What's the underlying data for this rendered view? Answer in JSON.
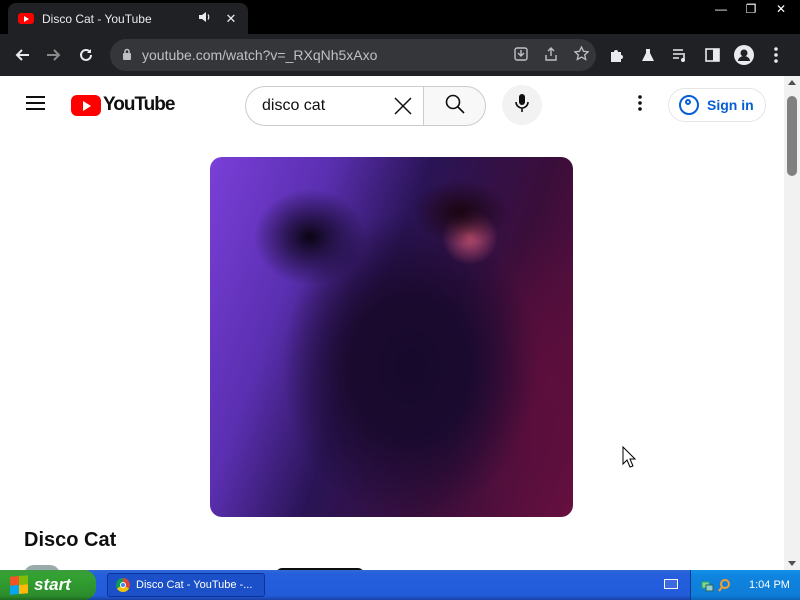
{
  "browser": {
    "tab": {
      "title": "Disco Cat - YouTube",
      "audio_icon": "speaker-icon",
      "close_glyph": "✕"
    },
    "window_controls": {
      "minimize": "—",
      "restore": "❐",
      "close": "✕"
    },
    "address": {
      "url": "youtube.com/watch?v=_RXqNh5xAxo"
    }
  },
  "youtube": {
    "logo_text": "YouTube",
    "search": {
      "value": "disco cat",
      "clear_glyph": "✕"
    },
    "signin_label": "Sign in",
    "video": {
      "title": "Disco Cat"
    },
    "colors": {
      "brand_red": "#ff0000",
      "link_blue": "#065fd4"
    }
  },
  "taskbar": {
    "start_label": "start",
    "task_item": "Disco Cat - YouTube -...",
    "clock": "1:04 PM"
  }
}
